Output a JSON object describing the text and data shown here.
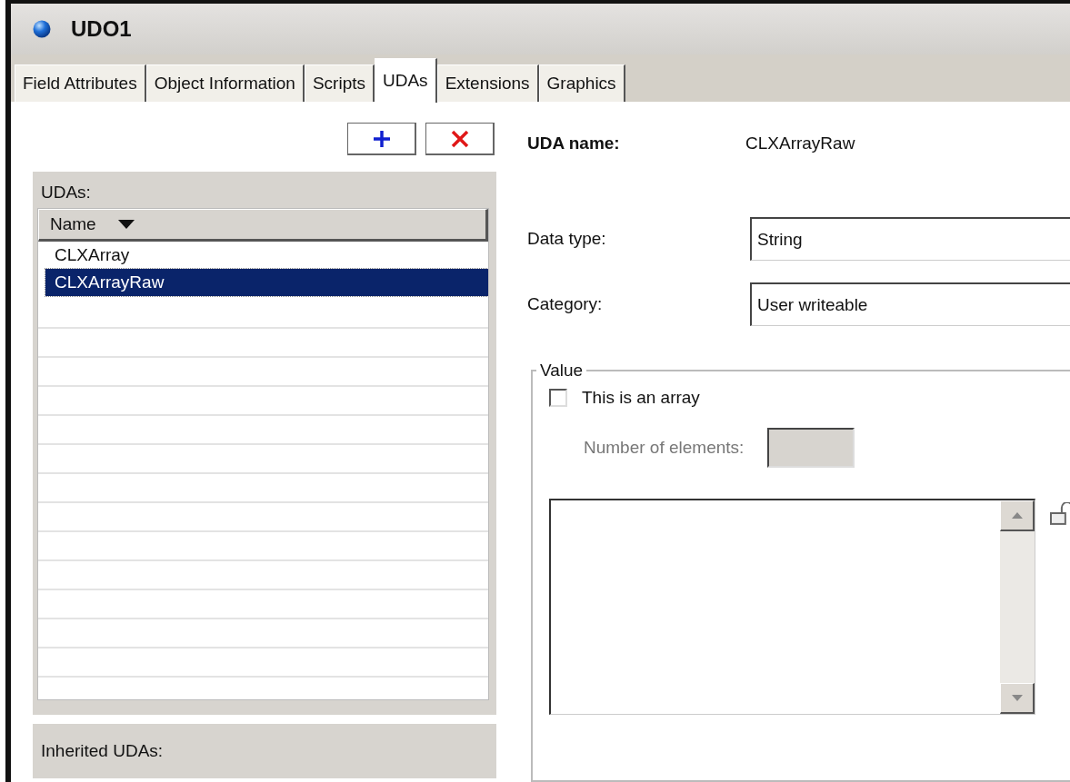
{
  "window": {
    "title": "UDO1"
  },
  "tabs": [
    {
      "label": "Field Attributes",
      "selected": false
    },
    {
      "label": "Object Information",
      "selected": false
    },
    {
      "label": "Scripts",
      "selected": false
    },
    {
      "label": "UDAs",
      "selected": true
    },
    {
      "label": "Extensions",
      "selected": false
    },
    {
      "label": "Graphics",
      "selected": false
    }
  ],
  "udas": {
    "label": "UDAs:",
    "column": "Name",
    "items": [
      {
        "name": "CLXArray",
        "selected": false
      },
      {
        "name": "CLXArrayRaw",
        "selected": true
      }
    ]
  },
  "inherited_udas": {
    "label": "Inherited UDAs:"
  },
  "details": {
    "uda_name_label": "UDA name:",
    "uda_name": "CLXArrayRaw",
    "data_type_label": "Data type:",
    "data_type": "String",
    "category_label": "Category:",
    "category": "User writeable"
  },
  "value_group": {
    "title": "Value",
    "array_checkbox": {
      "label": "This is an array",
      "checked": false
    },
    "number_of_elements": {
      "label": "Number of elements:",
      "disabled": true
    }
  }
}
